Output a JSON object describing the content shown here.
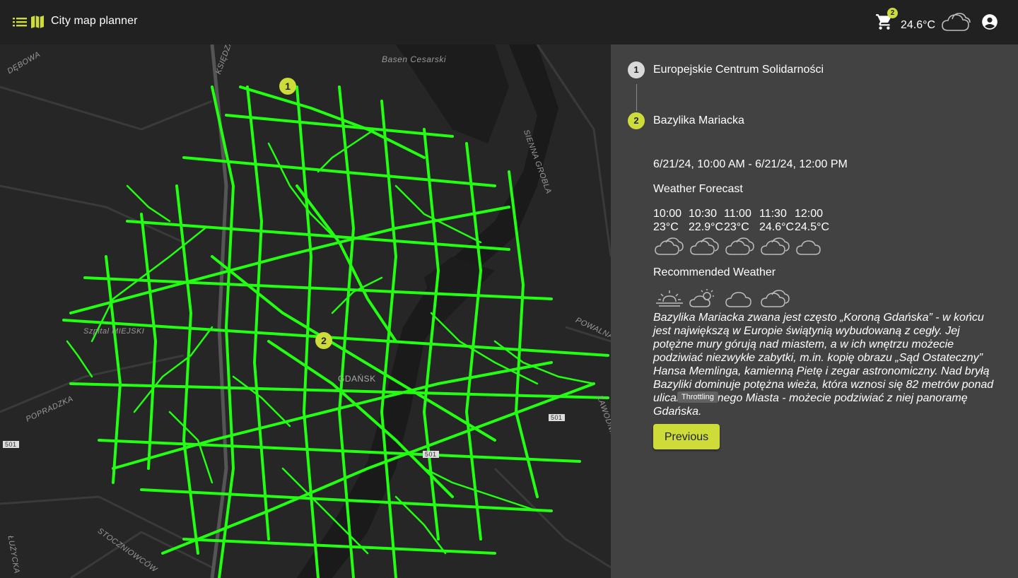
{
  "header": {
    "title": "City map planner",
    "cart_count": "2",
    "temperature": "24.6°C",
    "weather_icon": "cloud-icon"
  },
  "map": {
    "labels": {
      "basen": "Basen Cesarski",
      "gdansk": "GDAŃSK",
      "szpital": "Szpital MIEJSKI",
      "popradzka": "POPRADZKA",
      "stoczniowcow": "STOCZNIOWCÓW",
      "debowa": "DĘBOWA",
      "ksiedza": "KSIĘDZA",
      "sienna": "SIENNA GROBLA",
      "powalna": "POWALNA",
      "zawodnikow": "ZAWODNIKÓW",
      "luzycka": "ŁUŻYCKA",
      "road501a": "501",
      "road501b": "501",
      "road501c": "501"
    },
    "pins": [
      "1",
      "2"
    ],
    "route_color": "#22ff11"
  },
  "itinerary": {
    "steps": [
      {
        "number": "1",
        "label": "Europejskie Centrum Solidarności"
      },
      {
        "number": "2",
        "label": "Bazylika Mariacka"
      }
    ],
    "date_range": "6/21/24, 10:00 AM - 6/21/24, 12:00 PM",
    "forecast_title": "Weather Forecast",
    "forecast": [
      {
        "time": "10:00",
        "temp": "23°C",
        "icon": "cloud-icon"
      },
      {
        "time": "10:30",
        "temp": "22.9°C",
        "icon": "cloud-icon"
      },
      {
        "time": "11:00",
        "temp": "23°C",
        "icon": "cloud-icon"
      },
      {
        "time": "11:30",
        "temp": "24.6°C",
        "icon": "cloud-icon"
      },
      {
        "time": "12:00",
        "temp": "24.5°C",
        "icon": "cloud-icon"
      }
    ],
    "recommended_title": "Recommended Weather",
    "recommended_icons": [
      "sunrise-icon",
      "partly-sunny-icon",
      "cloud-icon",
      "cloudy-icon"
    ],
    "description": "Bazylika Mariacka zwana jest często „Koroną Gdańska” - w końcu jest największą w Europie świątynią wybudowaną z cegły. Jej potężne mury górują nad miastem, a w ich wnętrzu możecie podziwiać niezwykłe zabytki, m.in. kopię obrazu „Sąd Ostateczny” Hansa Memlinga, kamienną Pietę i zegar astronomiczny. Nad bryłą Bazyliki dominuje potężna wieża, która wznosi się 82 metrów ponad ulicami Głównego Miasta - możecie podziwiać z niej panoramę Gdańska.",
    "tooltip": "Throttling",
    "previous_label": "Previous"
  }
}
